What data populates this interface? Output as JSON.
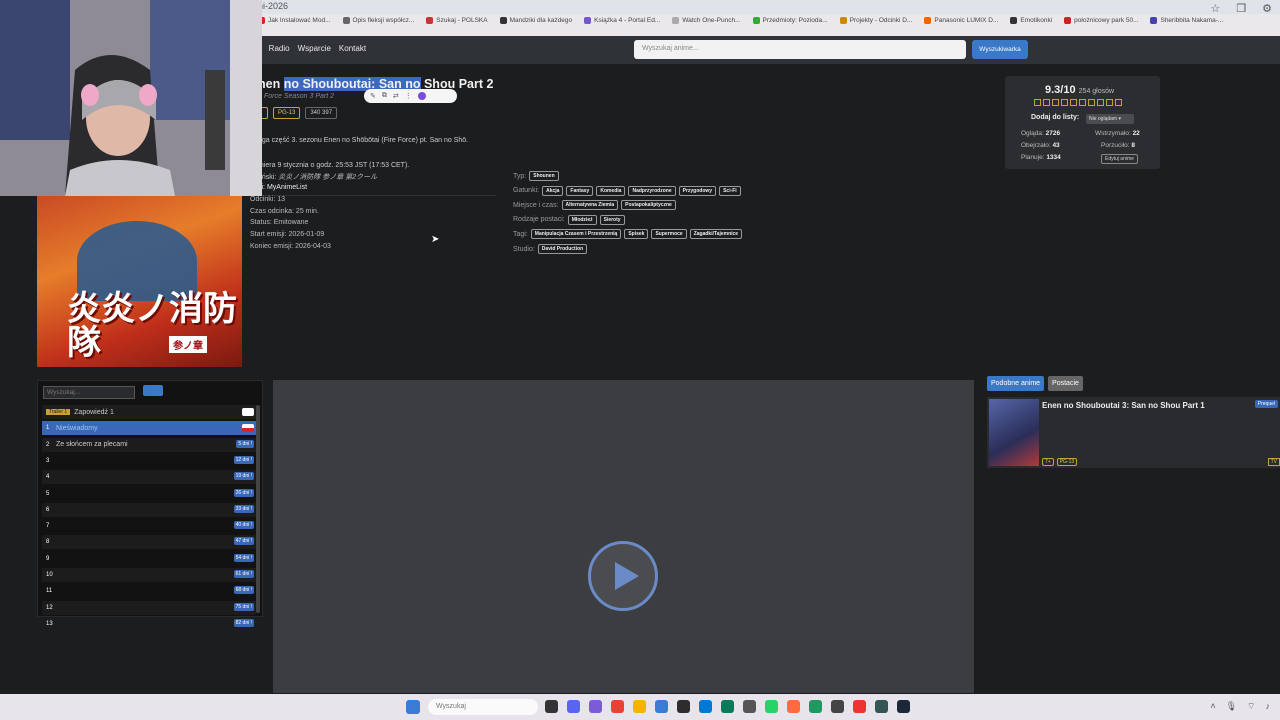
{
  "browser": {
    "tab_title": "ni-2026",
    "bookmarks": [
      {
        "label": "Jak Instalować Mod...",
        "color": "#d22"
      },
      {
        "label": "Opis fleksji współcz...",
        "color": "#666"
      },
      {
        "label": "Szukaj - POLSKA",
        "color": "#c33"
      },
      {
        "label": "Mandziki dla każdego",
        "color": "#333"
      },
      {
        "label": "Książka 4 - Portal Ed...",
        "color": "#7755cc"
      },
      {
        "label": "Watch One-Punch...",
        "color": "#aaa"
      },
      {
        "label": "Przedmioty: Pozioda...",
        "color": "#3a3"
      },
      {
        "label": "Projekty - Odcinki D...",
        "color": "#c80"
      },
      {
        "label": "Panasonic LUMIX D...",
        "color": "#e60"
      },
      {
        "label": "Emotikonki",
        "color": "#333"
      },
      {
        "label": "położnicowy park 50...",
        "color": "#c22"
      },
      {
        "label": "Sheribbita Nakama-...",
        "color": "#44a"
      }
    ]
  },
  "nav": {
    "links": [
      "m",
      "Radio",
      "Wsparcie",
      "Kontakt"
    ],
    "search_placeholder": "Wyszukaj anime...",
    "search_button": "Wyszukiwarka"
  },
  "anime": {
    "title_prefix": "nen ",
    "title_highlight": "no Shouboutai: San no",
    "title_suffix": " Shou Part 2",
    "subtitle": "Force Season 3 Part 2",
    "badges": [
      "",
      "PG-13",
      "340 397"
    ],
    "description": "uga część 3. sezonu Enen no Shōbōtai (Fire Force) pt. San no Shō.",
    "premiere": "miera 9 stycznia o godz. 25:53 JST (17:53 CET).",
    "japanese_label": "oński:",
    "japanese_title": "炎炎ノ消防隊 参ノ章 第2クール",
    "links_label": "ki:",
    "links_value": "MyAnimeList",
    "info": [
      {
        "label": "Odcinki:",
        "value": "13"
      },
      {
        "label": "Czas odcinka:",
        "value": "25 min."
      },
      {
        "label": "Status:",
        "value": "Emitowane"
      },
      {
        "label": "Start emisji:",
        "value": "2026-01-09"
      },
      {
        "label": "Koniec emisji:",
        "value": "2026-04-03"
      }
    ],
    "tag_rows": [
      {
        "label": "Typ:",
        "tags": [
          "Shounen"
        ]
      },
      {
        "label": "Gatunki:",
        "tags": [
          "Akcja",
          "Fantasy",
          "Komedia",
          "Nadprzyrodzone",
          "Przygodowy",
          "Sci-Fi"
        ]
      },
      {
        "label": "Miejsce i czas:",
        "tags": [
          "Alternatywna Ziemia",
          "Postapokaliptyczne"
        ]
      },
      {
        "label": "Rodzaje postaci:",
        "tags": [
          "Młodzież",
          "Sieroty"
        ]
      },
      {
        "label": "Tagi:",
        "tags": [
          "Manipulacja Czasem i Przestrzenią",
          "Spisek",
          "Supermoce",
          "Zagadki/Tajemnice"
        ]
      },
      {
        "label": "Studio:",
        "tags": [
          "David Production"
        ]
      }
    ],
    "poster_title": "炎炎ノ消防隊",
    "poster_sub": "参ノ章"
  },
  "rating": {
    "score": "9.3/10",
    "votes": "254 głosów",
    "star_count": 10,
    "add_label": "Dodaj do listy:",
    "add_select": "Nie oglądam",
    "stats": [
      {
        "label": "Ogląda:",
        "value": "2726"
      },
      {
        "label": "Wstrzymało:",
        "value": "22"
      },
      {
        "label": "Obejrzało:",
        "value": "43"
      },
      {
        "label": "Porzuciło:",
        "value": "8"
      },
      {
        "label": "Planuje:",
        "value": "1334"
      }
    ],
    "edit_button": "Edytuj anime"
  },
  "episodes": {
    "search_placeholder": "Wyszukaj...",
    "items": [
      {
        "num": "Trailer 1",
        "title": "Zapowiedź 1",
        "right": "",
        "type": "trailer"
      },
      {
        "num": "1",
        "title": "Nieświadomy",
        "right": "",
        "type": "active"
      },
      {
        "num": "2",
        "title": "Ze słońcem za plecami",
        "right": "5 dni !",
        "type": "normal"
      },
      {
        "num": "3",
        "title": "",
        "right": "12 dni !",
        "type": "normal"
      },
      {
        "num": "4",
        "title": "",
        "right": "19 dni !",
        "type": "normal"
      },
      {
        "num": "5",
        "title": "",
        "right": "26 dni !",
        "type": "normal"
      },
      {
        "num": "6",
        "title": "",
        "right": "33 dni !",
        "type": "normal"
      },
      {
        "num": "7",
        "title": "",
        "right": "40 dni !",
        "type": "normal"
      },
      {
        "num": "8",
        "title": "",
        "right": "47 dni !",
        "type": "normal"
      },
      {
        "num": "9",
        "title": "",
        "right": "54 dni !",
        "type": "normal"
      },
      {
        "num": "10",
        "title": "",
        "right": "61 dni !",
        "type": "normal"
      },
      {
        "num": "11",
        "title": "",
        "right": "68 dni !",
        "type": "normal"
      },
      {
        "num": "12",
        "title": "",
        "right": "75 dni !",
        "type": "normal"
      },
      {
        "num": "13",
        "title": "",
        "right": "82 dni !",
        "type": "normal"
      }
    ]
  },
  "sidebar": {
    "tabs": [
      "Podobne anime",
      "Postacie"
    ],
    "similar": {
      "title": "Enen no Shouboutai 3: San no Shou Part 1",
      "badge": "Prequel",
      "tags": [
        "7+",
        "PG-13"
      ],
      "type": "TV"
    }
  },
  "taskbar": {
    "search_placeholder": "Wyszukaj"
  }
}
